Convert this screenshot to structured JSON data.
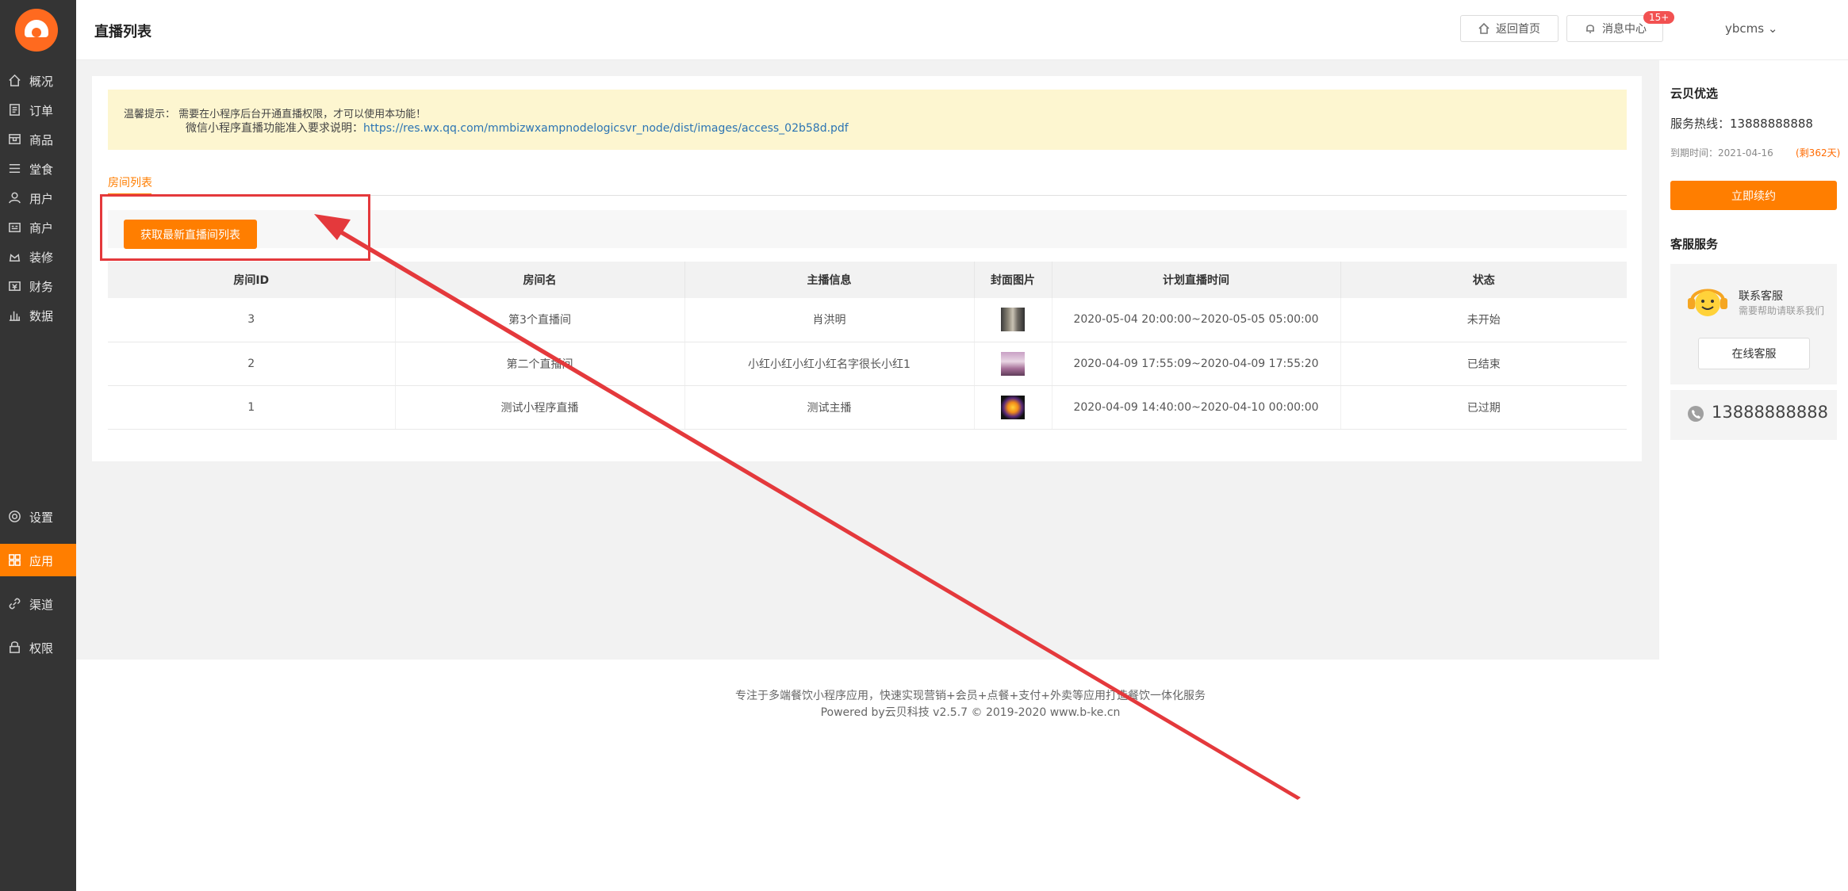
{
  "sidebar": {
    "items": [
      {
        "label": "概况",
        "icon": "home-icon"
      },
      {
        "label": "订单",
        "icon": "order-icon"
      },
      {
        "label": "商品",
        "icon": "goods-icon"
      },
      {
        "label": "堂食",
        "icon": "dine-in-icon"
      },
      {
        "label": "用户",
        "icon": "user-icon"
      },
      {
        "label": "商户",
        "icon": "merchant-icon"
      },
      {
        "label": "装修",
        "icon": "decorate-icon"
      },
      {
        "label": "财务",
        "icon": "finance-icon"
      },
      {
        "label": "数据",
        "icon": "data-icon"
      },
      {
        "label": "设置",
        "icon": "settings-icon"
      },
      {
        "label": "应用",
        "icon": "apps-icon"
      },
      {
        "label": "渠道",
        "icon": "channel-icon"
      },
      {
        "label": "权限",
        "icon": "lock-icon"
      }
    ],
    "active": "应用"
  },
  "header": {
    "title": "直播列表",
    "home_label": "返回首页",
    "msg_label": "消息中心",
    "msg_badge": "15+",
    "user": "ybcms"
  },
  "notice": {
    "line1": "温馨提示： 需要在小程序后台开通直播权限，才可以使用本功能！",
    "line2_prefix": "微信小程序直播功能准入要求说明：",
    "line2_link": "https://res.wx.qq.com/mmbizwxampnodelogicsvr_node/dist/images/access_02b58d.pdf"
  },
  "tab": "房间列表",
  "fetch_button": "获取最新直播间列表",
  "table": {
    "headers": [
      "房间ID",
      "房间名",
      "主播信息",
      "封面图片",
      "计划直播时间",
      "状态"
    ],
    "rows": [
      {
        "id": "3",
        "name": "第3个直播间",
        "anchor": "肖洪明",
        "time": "2020-05-04 20:00:00~2020-05-05 05:00:00",
        "status": "未开始"
      },
      {
        "id": "2",
        "name": "第二个直播间",
        "anchor": "小红小红小红小红名字很长小红1",
        "time": "2020-04-09 17:55:09~2020-04-09 17:55:20",
        "status": "已结束"
      },
      {
        "id": "1",
        "name": "测试小程序直播",
        "anchor": "测试主播",
        "time": "2020-04-09 14:40:00~2020-04-10 00:00:00",
        "status": "已过期"
      }
    ]
  },
  "right": {
    "title": "云贝优选",
    "hotline": "服务热线：13888888888",
    "expire": "到期时间：2021-04-16",
    "remaining": "(剩362天)",
    "renew": "立即续约",
    "service_title": "客服服务",
    "contact": "联系客服",
    "contact_desc": "需要帮助请联系我们",
    "online": "在线客服",
    "phone": "13888888888"
  },
  "footer": {
    "line1": "专注于多端餐饮小程序应用，快速实现营销+会员+点餐+支付+外卖等应用打造餐饮一体化服务",
    "line2": "Powered by云贝科技 v2.5.7 © 2019-2020 www.b-ke.cn"
  },
  "colors": {
    "accent": "#ff7e00",
    "sidebar": "#343434",
    "annotation": "#e4393c"
  }
}
